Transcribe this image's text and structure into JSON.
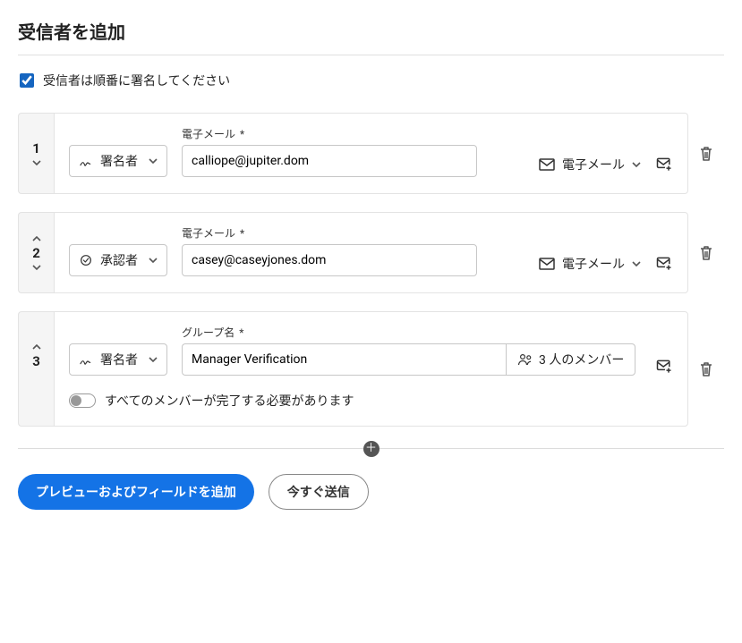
{
  "page_title": "受信者を追加",
  "sign_in_order": {
    "label": "受信者は順番に署名してください",
    "checked": true
  },
  "field_labels": {
    "email": "電子メール",
    "group_name": "グループ名",
    "required_mark": "*"
  },
  "roles": {
    "signer": "署名者",
    "approver": "承認者"
  },
  "auth": {
    "email_label": "電子メール"
  },
  "group": {
    "members_label": "3 人のメンバー",
    "all_must_complete_label": "すべてのメンバーが完了する必要があります",
    "all_must_complete": false
  },
  "recipients": [
    {
      "order": "1",
      "role": "signer",
      "email": "calliope@jupiter.dom"
    },
    {
      "order": "2",
      "role": "approver",
      "email": "casey@caseyjones.dom"
    },
    {
      "order": "3",
      "role": "signer",
      "group_name": "Manager Verification"
    }
  ],
  "footer": {
    "preview": "プレビューおよびフィールドを追加",
    "send_now": "今すぐ送信"
  }
}
